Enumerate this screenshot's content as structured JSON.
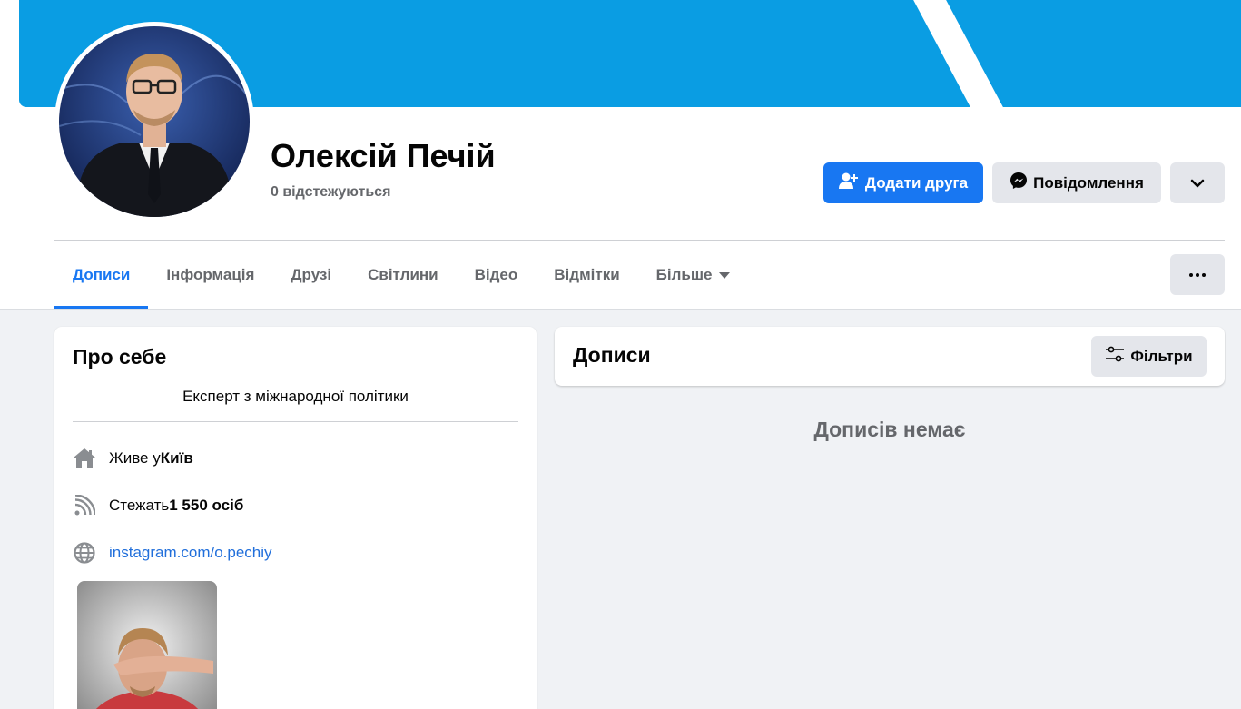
{
  "profile": {
    "name": "Олексій Печій",
    "followers": "0 відстежуються"
  },
  "actions": {
    "add_friend": "Додати друга",
    "message": "Повідомлення"
  },
  "tabs": [
    {
      "label": "Дописи",
      "active": true
    },
    {
      "label": "Інформація"
    },
    {
      "label": "Друзі"
    },
    {
      "label": "Світлини"
    },
    {
      "label": "Відео"
    },
    {
      "label": "Відмітки"
    },
    {
      "label": "Більше"
    }
  ],
  "about": {
    "title": "Про себе",
    "bio": "Експерт з міжнародної політики",
    "lives_prefix": "Живе у ",
    "lives_city": "Київ",
    "follows_prefix": "Стежать ",
    "follows_count": "1 550 осіб",
    "link": "instagram.com/o.pechiy"
  },
  "posts": {
    "title": "Дописи",
    "filter_label": "Фільтри",
    "empty_text": "Дописів немає"
  },
  "icons": {
    "add_friend": "add-friend-icon",
    "message": "messenger-icon",
    "caret": "chevron-down-icon",
    "more": "more-dots-icon",
    "home": "home-icon",
    "rss": "rss-icon",
    "globe": "globe-icon",
    "filter": "filter-sliders-icon"
  },
  "colors": {
    "primary": "#1877f2",
    "cover": "#0a9de3",
    "link": "#216fdb"
  }
}
